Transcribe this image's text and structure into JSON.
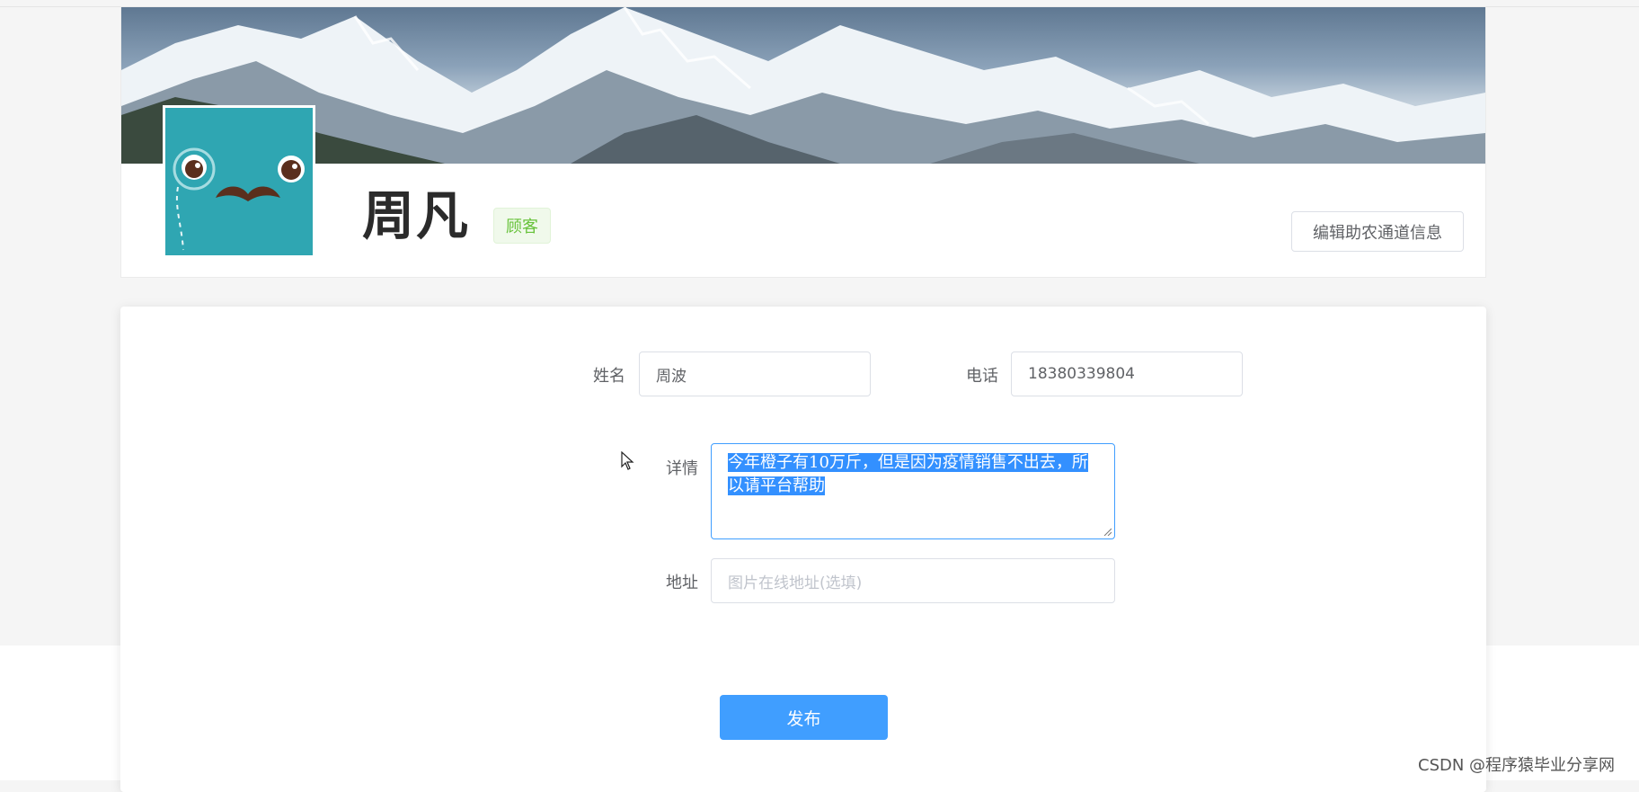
{
  "profile": {
    "name": "周凡",
    "role": "顾客",
    "edit_label": "编辑助农通道信息"
  },
  "form": {
    "name_label": "姓名",
    "name_value": "周波",
    "phone_label": "电话",
    "phone_value": "18380339804",
    "detail_label": "详情",
    "detail_value": "今年橙子有10万斤，但是因为疫情销售不出去，所以请平台帮助",
    "address_label": "地址",
    "address_placeholder": "图片在线地址(选填)",
    "submit_label": "发布"
  },
  "watermark": "CSDN @程序猿毕业分享网",
  "colors": {
    "primary": "#409eff",
    "tag_text": "#67c23a",
    "tag_bg": "#f0f9eb",
    "avatar_bg": "#2fa6b2"
  },
  "icons": {
    "avatar": "monocle-mustache-face",
    "cursor": "mouse-pointer-icon"
  }
}
